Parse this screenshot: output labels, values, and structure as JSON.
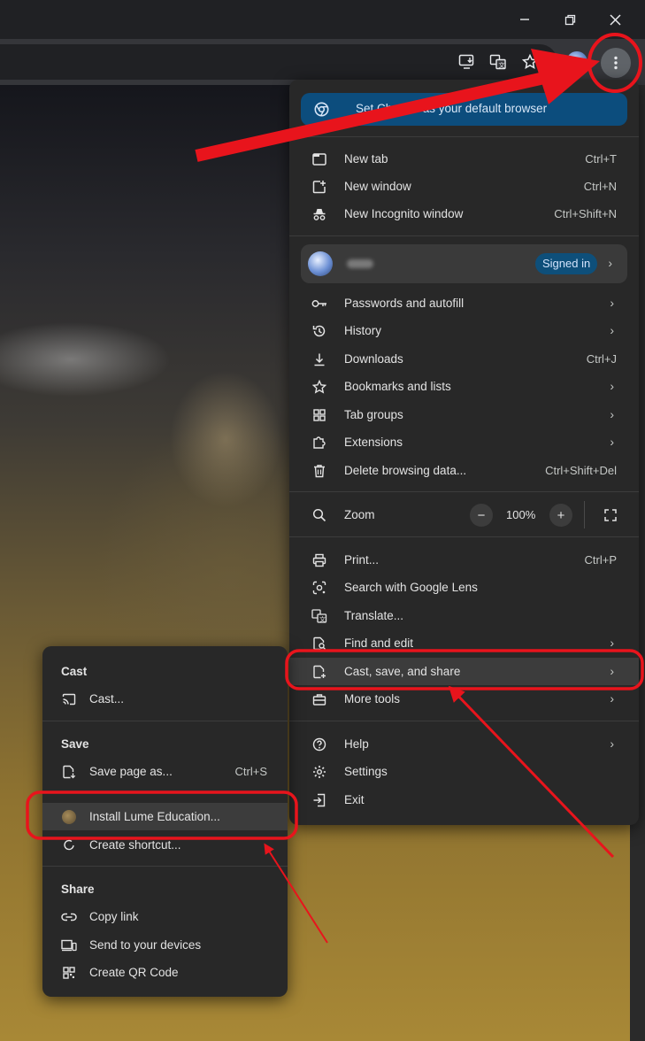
{
  "window": {
    "controls": [
      "minimize",
      "restore",
      "close"
    ]
  },
  "toolbar": {
    "icons": [
      "install-app-icon",
      "translate-icon",
      "star-icon",
      "profile-icon",
      "kebab-menu-icon"
    ]
  },
  "menu": {
    "banner": {
      "label": "Set Chrome as your default browser"
    },
    "items_top": [
      {
        "label": "New tab",
        "shortcut": "Ctrl+T",
        "icon": "new-tab-icon"
      },
      {
        "label": "New window",
        "shortcut": "Ctrl+N",
        "icon": "new-window-icon"
      },
      {
        "label": "New Incognito window",
        "shortcut": "Ctrl+Shift+N",
        "icon": "incognito-icon"
      }
    ],
    "profile": {
      "status": "Signed in"
    },
    "items_mid": [
      {
        "label": "Passwords and autofill",
        "icon": "key-icon"
      },
      {
        "label": "History",
        "icon": "history-icon"
      },
      {
        "label": "Downloads",
        "shortcut": "Ctrl+J",
        "icon": "download-icon"
      },
      {
        "label": "Bookmarks and lists",
        "icon": "star-icon"
      },
      {
        "label": "Tab groups",
        "icon": "tab-groups-icon"
      },
      {
        "label": "Extensions",
        "icon": "puzzle-icon"
      },
      {
        "label": "Delete browsing data...",
        "shortcut": "Ctrl+Shift+Del",
        "icon": "trash-icon"
      }
    ],
    "zoom": {
      "label": "Zoom",
      "value": "100%",
      "minus": "−",
      "plus": "+"
    },
    "items_tools": [
      {
        "label": "Print...",
        "shortcut": "Ctrl+P",
        "icon": "print-icon"
      },
      {
        "label": "Search with Google Lens",
        "icon": "lens-icon"
      },
      {
        "label": "Translate...",
        "icon": "translate-icon"
      },
      {
        "label": "Find and edit",
        "icon": "find-icon"
      },
      {
        "label": "Cast, save, and share",
        "icon": "cast-save-share-icon"
      },
      {
        "label": "More tools",
        "icon": "toolbox-icon"
      }
    ],
    "items_bottom": [
      {
        "label": "Help",
        "icon": "help-icon"
      },
      {
        "label": "Settings",
        "icon": "gear-icon"
      },
      {
        "label": "Exit",
        "icon": "exit-icon"
      }
    ]
  },
  "submenu": {
    "cast_heading": "Cast",
    "cast_item": "Cast...",
    "save_heading": "Save",
    "save_page": {
      "label": "Save page as...",
      "shortcut": "Ctrl+S"
    },
    "install": "Install Lume Education...",
    "shortcut": "Create shortcut...",
    "share_heading": "Share",
    "share_items": [
      "Copy link",
      "Send to your devices",
      "Create QR Code"
    ]
  },
  "colors": {
    "annotation": "#e8141c",
    "menu_bg": "#282828",
    "banner_bg": "#0c4d7d"
  }
}
